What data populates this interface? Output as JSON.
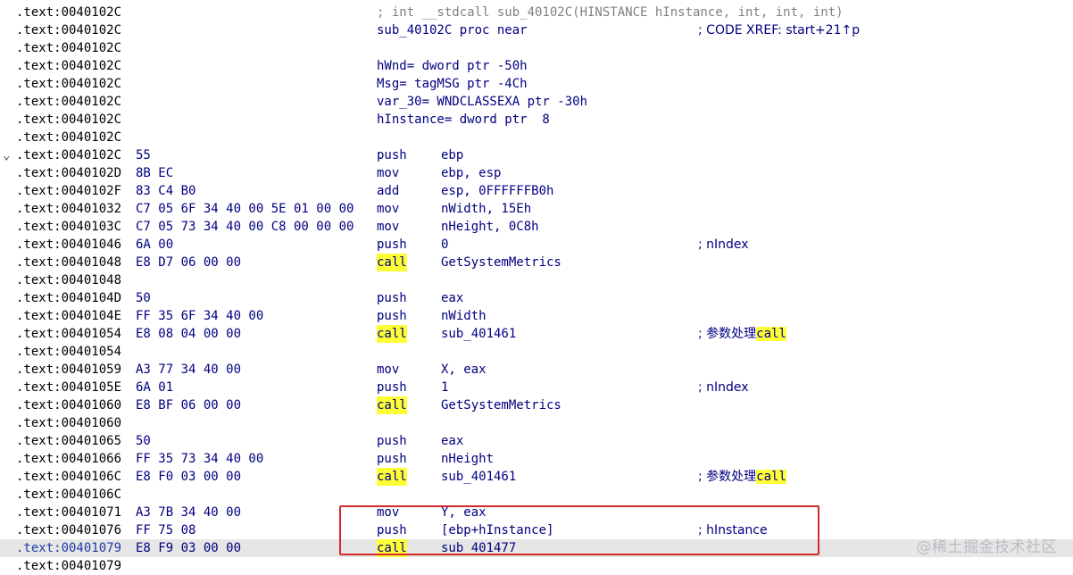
{
  "listing": {
    "rows": [
      {
        "addr": ".text:0040102C",
        "bytes": "",
        "instr": "; int __stdcall sub_40102C(HINSTANCE hInstance, int, int, int)",
        "mnemonic": "",
        "operands": "",
        "comment": "",
        "kind": "header"
      },
      {
        "addr": ".text:0040102C",
        "bytes": "",
        "instr": "sub_40102C proc near",
        "mnemonic": "",
        "operands": "",
        "comment": "; CODE XREF: start+21↑p",
        "kind": "label"
      },
      {
        "addr": ".text:0040102C",
        "bytes": "",
        "instr": "",
        "mnemonic": "",
        "operands": "",
        "comment": "",
        "kind": "blank"
      },
      {
        "addr": ".text:0040102C",
        "bytes": "",
        "instr": "hWnd= dword ptr -50h",
        "mnemonic": "",
        "operands": "",
        "comment": "",
        "kind": "var"
      },
      {
        "addr": ".text:0040102C",
        "bytes": "",
        "instr": "Msg= tagMSG ptr -4Ch",
        "mnemonic": "",
        "operands": "",
        "comment": "",
        "kind": "var"
      },
      {
        "addr": ".text:0040102C",
        "bytes": "",
        "instr": "var_30= WNDCLASSEXA ptr -30h",
        "mnemonic": "",
        "operands": "",
        "comment": "",
        "kind": "var"
      },
      {
        "addr": ".text:0040102C",
        "bytes": "",
        "instr": "hInstance= dword ptr  8",
        "mnemonic": "",
        "operands": "",
        "comment": "",
        "kind": "var"
      },
      {
        "addr": ".text:0040102C",
        "bytes": "",
        "instr": "",
        "mnemonic": "",
        "operands": "",
        "comment": "",
        "kind": "blank"
      },
      {
        "addr": ".text:0040102C",
        "bytes": "55",
        "instr": "",
        "mnemonic": "push",
        "operands": "ebp",
        "comment": "",
        "kind": "code",
        "fold": "⌄"
      },
      {
        "addr": ".text:0040102D",
        "bytes": "8B EC",
        "instr": "",
        "mnemonic": "mov",
        "operands": "ebp, esp",
        "comment": "",
        "kind": "code"
      },
      {
        "addr": ".text:0040102F",
        "bytes": "83 C4 B0",
        "instr": "",
        "mnemonic": "add",
        "operands": "esp, 0FFFFFFB0h",
        "comment": "",
        "kind": "code"
      },
      {
        "addr": ".text:00401032",
        "bytes": "C7 05 6F 34 40 00 5E 01 00 00",
        "instr": "",
        "mnemonic": "mov",
        "operands": "nWidth, 15Eh",
        "comment": "",
        "kind": "code"
      },
      {
        "addr": ".text:0040103C",
        "bytes": "C7 05 73 34 40 00 C8 00 00 00",
        "instr": "",
        "mnemonic": "mov",
        "operands": "nHeight, 0C8h",
        "comment": "",
        "kind": "code"
      },
      {
        "addr": ".text:00401046",
        "bytes": "6A 00",
        "instr": "",
        "mnemonic": "push",
        "operands": "0",
        "comment": "; nIndex",
        "kind": "code"
      },
      {
        "addr": ".text:00401048",
        "bytes": "E8 D7 06 00 00",
        "instr": "",
        "mnemonic": "call",
        "operands": "GetSystemMetrics",
        "comment": "",
        "kind": "call"
      },
      {
        "addr": ".text:00401048",
        "bytes": "",
        "instr": "",
        "mnemonic": "",
        "operands": "",
        "comment": "",
        "kind": "blank"
      },
      {
        "addr": ".text:0040104D",
        "bytes": "50",
        "instr": "",
        "mnemonic": "push",
        "operands": "eax",
        "comment": "",
        "kind": "code"
      },
      {
        "addr": ".text:0040104E",
        "bytes": "FF 35 6F 34 40 00",
        "instr": "",
        "mnemonic": "push",
        "operands": "nWidth",
        "comment": "",
        "kind": "code"
      },
      {
        "addr": ".text:00401054",
        "bytes": "E8 08 04 00 00",
        "instr": "",
        "mnemonic": "call",
        "operands": "sub_401461",
        "comment": "; 参数处理",
        "comment_hl": "call",
        "kind": "call"
      },
      {
        "addr": ".text:00401054",
        "bytes": "",
        "instr": "",
        "mnemonic": "",
        "operands": "",
        "comment": "",
        "kind": "blank"
      },
      {
        "addr": ".text:00401059",
        "bytes": "A3 77 34 40 00",
        "instr": "",
        "mnemonic": "mov",
        "operands": "X, eax",
        "comment": "",
        "kind": "code"
      },
      {
        "addr": ".text:0040105E",
        "bytes": "6A 01",
        "instr": "",
        "mnemonic": "push",
        "operands": "1",
        "comment": "; nIndex",
        "kind": "code"
      },
      {
        "addr": ".text:00401060",
        "bytes": "E8 BF 06 00 00",
        "instr": "",
        "mnemonic": "call",
        "operands": "GetSystemMetrics",
        "comment": "",
        "kind": "call"
      },
      {
        "addr": ".text:00401060",
        "bytes": "",
        "instr": "",
        "mnemonic": "",
        "operands": "",
        "comment": "",
        "kind": "blank"
      },
      {
        "addr": ".text:00401065",
        "bytes": "50",
        "instr": "",
        "mnemonic": "push",
        "operands": "eax",
        "comment": "",
        "kind": "code"
      },
      {
        "addr": ".text:00401066",
        "bytes": "FF 35 73 34 40 00",
        "instr": "",
        "mnemonic": "push",
        "operands": "nHeight",
        "comment": "",
        "kind": "code"
      },
      {
        "addr": ".text:0040106C",
        "bytes": "E8 F0 03 00 00",
        "instr": "",
        "mnemonic": "call",
        "operands": "sub_401461",
        "comment": "; 参数处理",
        "comment_hl": "call",
        "kind": "call"
      },
      {
        "addr": ".text:0040106C",
        "bytes": "",
        "instr": "",
        "mnemonic": "",
        "operands": "",
        "comment": "",
        "kind": "blank"
      },
      {
        "addr": ".text:00401071",
        "bytes": "A3 7B 34 40 00",
        "instr": "",
        "mnemonic": "mov",
        "operands": "Y, eax",
        "comment": "",
        "kind": "code"
      },
      {
        "addr": ".text:00401076",
        "bytes": "FF 75 08",
        "instr": "",
        "mnemonic": "push",
        "operands": "[ebp+hInstance]",
        "comment": "; hInstance",
        "kind": "code"
      },
      {
        "addr": ".text:00401079",
        "bytes": "E8 F9 03 00 00",
        "instr": "",
        "mnemonic": "call",
        "operands": "sub_401477",
        "comment": "",
        "kind": "call",
        "current": true
      },
      {
        "addr": ".text:00401079",
        "bytes": "",
        "instr": "",
        "mnemonic": "",
        "operands": "",
        "comment": "",
        "kind": "blank"
      }
    ]
  },
  "watermark": "@稀土掘金技术社区",
  "colors": {
    "code_text": "#000080",
    "address_text": "#000000",
    "highlight": "#ffff36",
    "current_line": "#e6e6e6",
    "annotation_box": "#d42a2a"
  },
  "icons": {
    "fold": "chevron-down-icon"
  }
}
